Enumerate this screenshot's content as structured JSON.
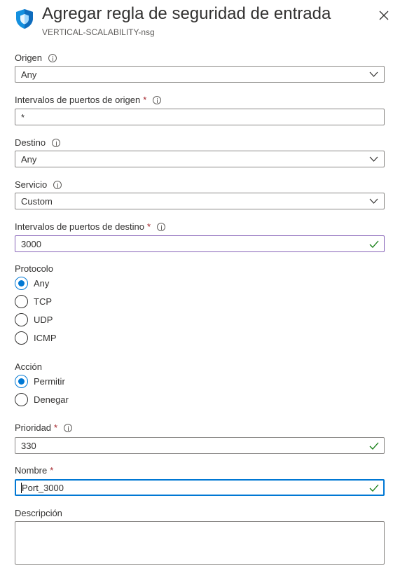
{
  "header": {
    "title": "Agregar regla de seguridad de entrada",
    "subtitle": "VERTICAL-SCALABILITY-nsg",
    "icon": "shield-icon",
    "close_icon": "close-icon"
  },
  "form": {
    "origen": {
      "label": "Origen",
      "value": "Any"
    },
    "puertos_origen": {
      "label": "Intervalos de puertos de origen",
      "required_mark": "*",
      "value": "*"
    },
    "destino": {
      "label": "Destino",
      "value": "Any"
    },
    "servicio": {
      "label": "Servicio",
      "value": "Custom"
    },
    "puertos_destino": {
      "label": "Intervalos de puertos de destino",
      "required_mark": "*",
      "value": "3000"
    },
    "protocolo": {
      "label": "Protocolo",
      "options": [
        "Any",
        "TCP",
        "UDP",
        "ICMP"
      ],
      "selected": "Any"
    },
    "accion": {
      "label": "Acción",
      "options": [
        "Permitir",
        "Denegar"
      ],
      "selected": "Permitir"
    },
    "prioridad": {
      "label": "Prioridad",
      "required_mark": "*",
      "value": "330"
    },
    "nombre": {
      "label": "Nombre",
      "required_mark": "*",
      "value": "Port_3000"
    },
    "descripcion": {
      "label": "Descripción",
      "value": ""
    }
  },
  "colors": {
    "accent": "#0078d4",
    "valid_check": "#107c10",
    "required": "#a4262c",
    "valid_border": "#8764b8"
  }
}
